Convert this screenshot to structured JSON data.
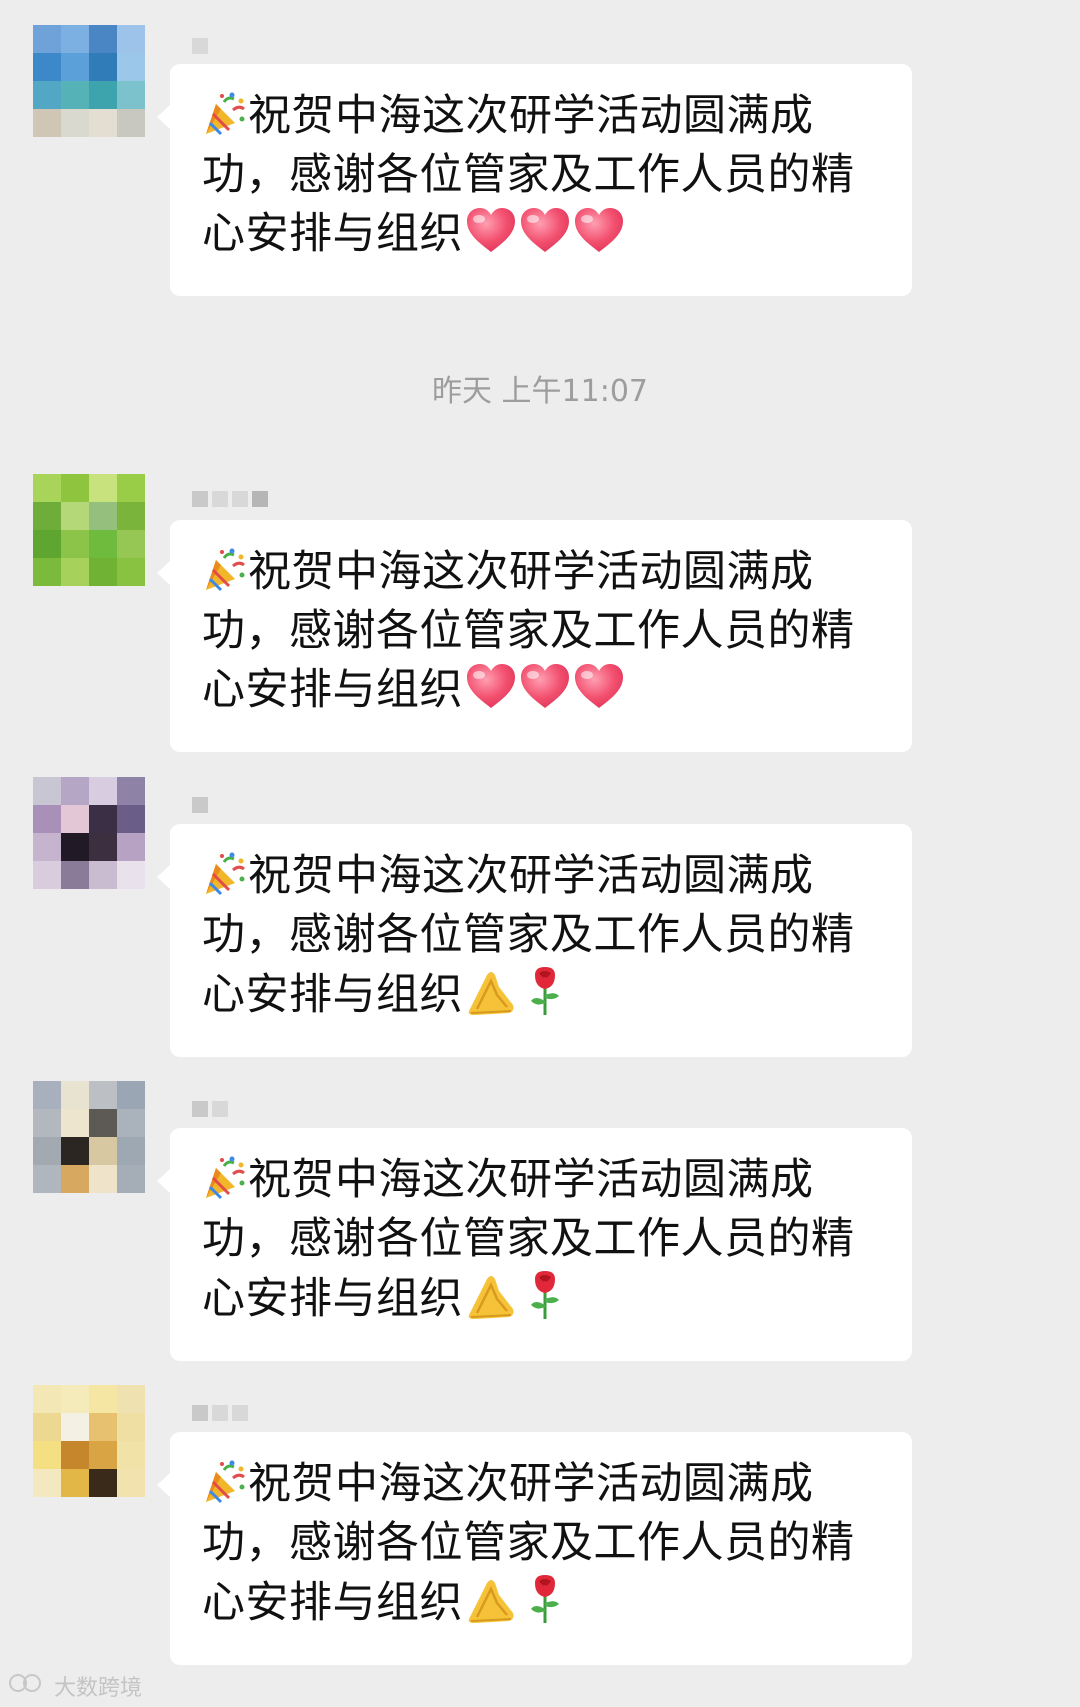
{
  "messages": [
    {
      "text": "祝贺中海这次研学活动圆满成功，感谢各位管家及工作人员的精心安排与组织",
      "emoji": [
        "party-popper",
        "heart",
        "heart",
        "heart"
      ],
      "avatar_palette": [
        "#6fa2d9",
        "#7db0e2",
        "#4b86c4",
        "#9ec3ea",
        "#3d88c9",
        "#5ba0d8",
        "#2f7cb9",
        "#9bc7eb",
        "#52a7c4",
        "#55b2b7",
        "#3da4ad",
        "#7cc2cc",
        "#cfc6b6",
        "#d9d9cf",
        "#e4ddd1",
        "#c8c7c0"
      ]
    },
    {
      "text": "祝贺中海这次研学活动圆满成功，感谢各位管家及工作人员的精心安排与组织",
      "emoji": [
        "party-popper",
        "heart",
        "heart",
        "heart"
      ],
      "avatar_palette": [
        "#a8d45a",
        "#8fc43f",
        "#c8e27d",
        "#9acd47",
        "#6fad3a",
        "#b4d877",
        "#95bf7c",
        "#7ab43a",
        "#5fa631",
        "#8cc44a",
        "#6fbb3e",
        "#96c653",
        "#7cba3c",
        "#a6d15a",
        "#6fb234",
        "#89c141"
      ]
    },
    {
      "text": "祝贺中海这次研学活动圆满成功，感谢各位管家及工作人员的精心安排与组织",
      "emoji": [
        "party-popper",
        "folded-hands",
        "rose"
      ],
      "avatar_palette": [
        "#c9c6d4",
        "#b5a6c6",
        "#d8cde0",
        "#8e82a6",
        "#a890b9",
        "#e4c7d6",
        "#3a2f45",
        "#6a5e88",
        "#c6b4cf",
        "#211a26",
        "#3c3040",
        "#b8a2c4",
        "#d9ccdc",
        "#8a7b98",
        "#c9bcd1",
        "#e9e2ec"
      ]
    },
    {
      "text": "祝贺中海这次研学活动圆满成功，感谢各位管家及工作人员的精心安排与组织",
      "emoji": [
        "party-popper",
        "folded-hands",
        "rose"
      ],
      "avatar_palette": [
        "#a7b0bc",
        "#e8e2d0",
        "#bcbfc4",
        "#9aa6b3",
        "#b3b8bf",
        "#ede5cd",
        "#5d5a55",
        "#aab2bb",
        "#a3a9b0",
        "#2b2622",
        "#d8c8a2",
        "#9ea8b2",
        "#b0b6be",
        "#d6a860",
        "#efe4c9",
        "#a5adb6"
      ]
    },
    {
      "text": "祝贺中海这次研学活动圆满成功，感谢各位管家及工作人员的精心安排与组织",
      "emoji": [
        "party-popper",
        "folded-hands",
        "rose"
      ],
      "avatar_palette": [
        "#f3e7b6",
        "#f5eab9",
        "#f6e6a4",
        "#f0e2b0",
        "#ecd891",
        "#f5f0e4",
        "#e8c170",
        "#efdfa2",
        "#f4df83",
        "#c6862b",
        "#d9a443",
        "#f1e2a7",
        "#f3e8bf",
        "#e3b747",
        "#3a2a19",
        "#f2e3ae"
      ]
    }
  ],
  "timestamp": "昨天 上午11:07",
  "watermark": "大数跨境"
}
